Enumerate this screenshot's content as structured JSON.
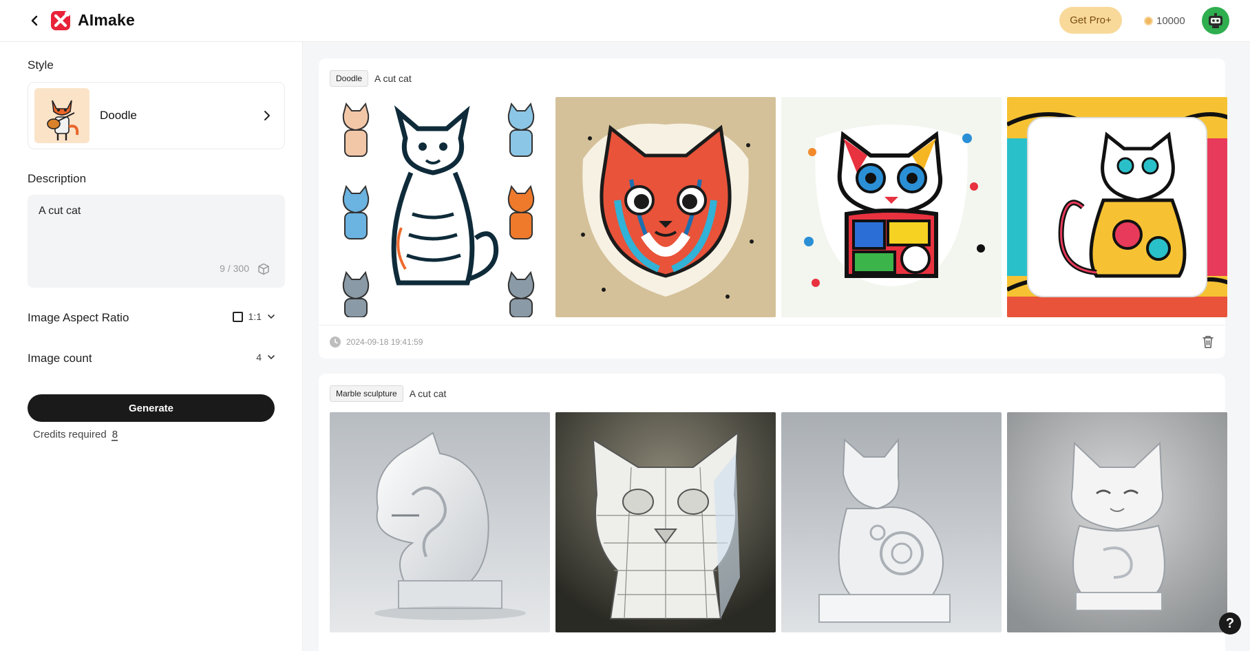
{
  "header": {
    "app_name": "AImake",
    "pro_label": "Get Pro+",
    "credits": "10000",
    "brand_color": "#e8233a"
  },
  "sidebar": {
    "style_label": "Style",
    "style_name": "Doodle",
    "description_label": "Description",
    "description_value": "A cut cat",
    "description_count": "9 / 300",
    "aspect_label": "Image Aspect Ratio",
    "aspect_value": "1:1",
    "count_label": "Image count",
    "count_value": "4",
    "generate_label": "Generate",
    "credits_required_label": "Credits required",
    "credits_required_value": "8"
  },
  "results": [
    {
      "style_tag": "Doodle",
      "prompt": "A cut cat",
      "timestamp": "2024-09-18 19:41:59"
    },
    {
      "style_tag": "Marble sculpture",
      "prompt": "A cut cat"
    }
  ],
  "help_label": "?"
}
